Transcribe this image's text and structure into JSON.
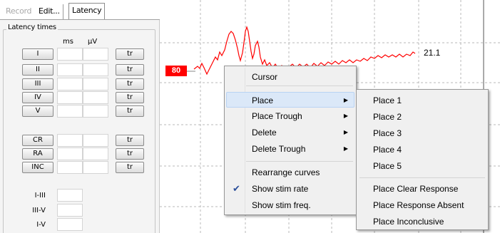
{
  "tabs": [
    {
      "label": "Record",
      "state": "disabled"
    },
    {
      "label": "Edit...",
      "state": "normal"
    },
    {
      "label": "Latency",
      "state": "active"
    }
  ],
  "latency": {
    "group_title": "Latency times",
    "col_ms": "ms",
    "col_uv": "µV",
    "peaks": [
      "I",
      "II",
      "III",
      "IV",
      "V"
    ],
    "responses": [
      "CR",
      "RA",
      "INC"
    ],
    "tr_label": "tr",
    "interpeaks": [
      "I-III",
      "III-V",
      "I-V"
    ]
  },
  "waveform": {
    "intensity_marker": "80",
    "intensity_marker_color": "#ff0000",
    "amplitude_label": "21.1",
    "trace_color": "#ff0000"
  },
  "context_menu": {
    "items": [
      {
        "label": "Cursor",
        "submenu": false,
        "checked": false
      },
      {
        "label": "Place",
        "submenu": true,
        "checked": false,
        "highlighted": true
      },
      {
        "label": "Place Trough",
        "submenu": true,
        "checked": false
      },
      {
        "label": "Delete",
        "submenu": true,
        "checked": false
      },
      {
        "label": "Delete Trough",
        "submenu": true,
        "checked": false
      },
      {
        "label": "Rearrange curves",
        "submenu": false,
        "checked": false
      },
      {
        "label": "Show stim rate",
        "submenu": false,
        "checked": true
      },
      {
        "label": "Show stim freq.",
        "submenu": false,
        "checked": false
      }
    ]
  },
  "place_submenu": {
    "items": [
      "Place 1",
      "Place 2",
      "Place 3",
      "Place 4",
      "Place 5",
      "Place Clear Response",
      "Place Response  Absent",
      "Place Inconclusive"
    ]
  },
  "icons": {
    "submenu_arrow": "triangle-right-icon",
    "check": "checkmark-icon"
  }
}
